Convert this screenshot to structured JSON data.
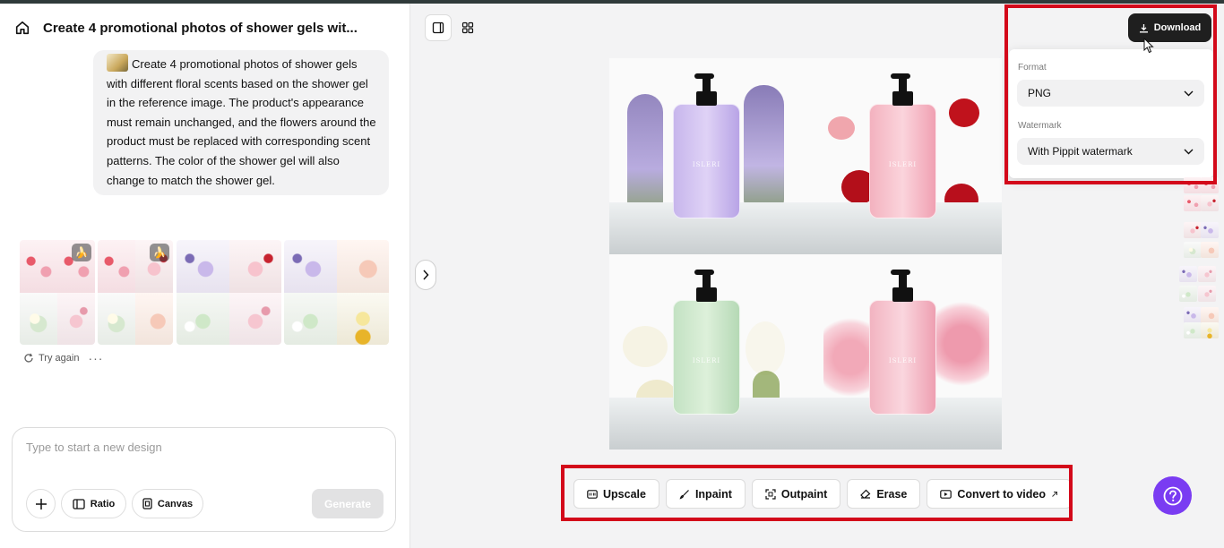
{
  "header": {
    "title": "Create 4 promotional photos of shower gels wit..."
  },
  "prompt": {
    "text": "Create 4 promotional photos of shower gels with different floral scents based on the shower gel in the reference image. The product's appearance must remain unchanged, and the flowers around the product must be replaced with corresponding scent patterns. The color of the shower gel will also change to match the shower gel."
  },
  "results": {
    "try_again_label": "Try again",
    "more_label": "···"
  },
  "composer": {
    "placeholder": "Type to start a new design",
    "add_icon": "plus-icon",
    "ratio_label": "Ratio",
    "canvas_label": "Canvas",
    "generate_label": "Generate"
  },
  "download": {
    "button_label": "Download",
    "format_label": "Format",
    "format_value": "PNG",
    "watermark_label": "Watermark",
    "watermark_value": "With Pippit watermark"
  },
  "canvas": {
    "brand_text": "ISLERI"
  },
  "actions": {
    "upscale": "Upscale",
    "inpaint": "Inpaint",
    "outpaint": "Outpaint",
    "erase": "Erase",
    "convert": "Convert to video"
  },
  "colors": {
    "highlight": "#d3091a",
    "help_button": "#7a3cf2",
    "download_button": "#1f1f1f"
  }
}
